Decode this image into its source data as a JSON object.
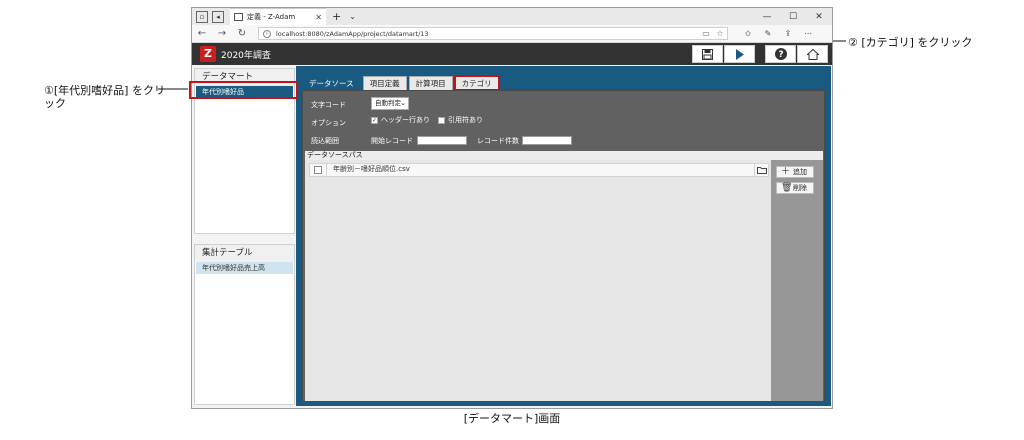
{
  "callouts": {
    "one": "①[年代別嗜好品] をクリック",
    "two": "② [カテゴリ] をクリック"
  },
  "caption": "[データマート]画面",
  "browser": {
    "tab_title": "定義 - Z-Adam",
    "url": "localhost:8080/zAdamApp/project/datamart/13"
  },
  "app": {
    "logo_letter": "Z",
    "title": "2020年調査"
  },
  "left_panel": {
    "datamart_header": "データマート",
    "datamart_items": [
      "年代別嗜好品"
    ],
    "aggregate_header": "集計テーブル",
    "aggregate_items": [
      "年代別嗜好品売上高"
    ]
  },
  "tabs": [
    "データソース",
    "項目定義",
    "計算項目",
    "カテゴリ"
  ],
  "form": {
    "char_code_label": "文字コード",
    "char_code_value": "自動判定",
    "option_label": "オプション",
    "opt_header": "ヘッダー行あり",
    "opt_quote": "引用符あり",
    "range_label": "読込範囲",
    "start_record_label": "開始レコード",
    "record_count_label": "レコード件数"
  },
  "datasource": {
    "header": "データソースパス",
    "files": [
      "年齢別－嗜好品順位.csv"
    ],
    "add_label": "追加",
    "delete_label": "削除"
  }
}
